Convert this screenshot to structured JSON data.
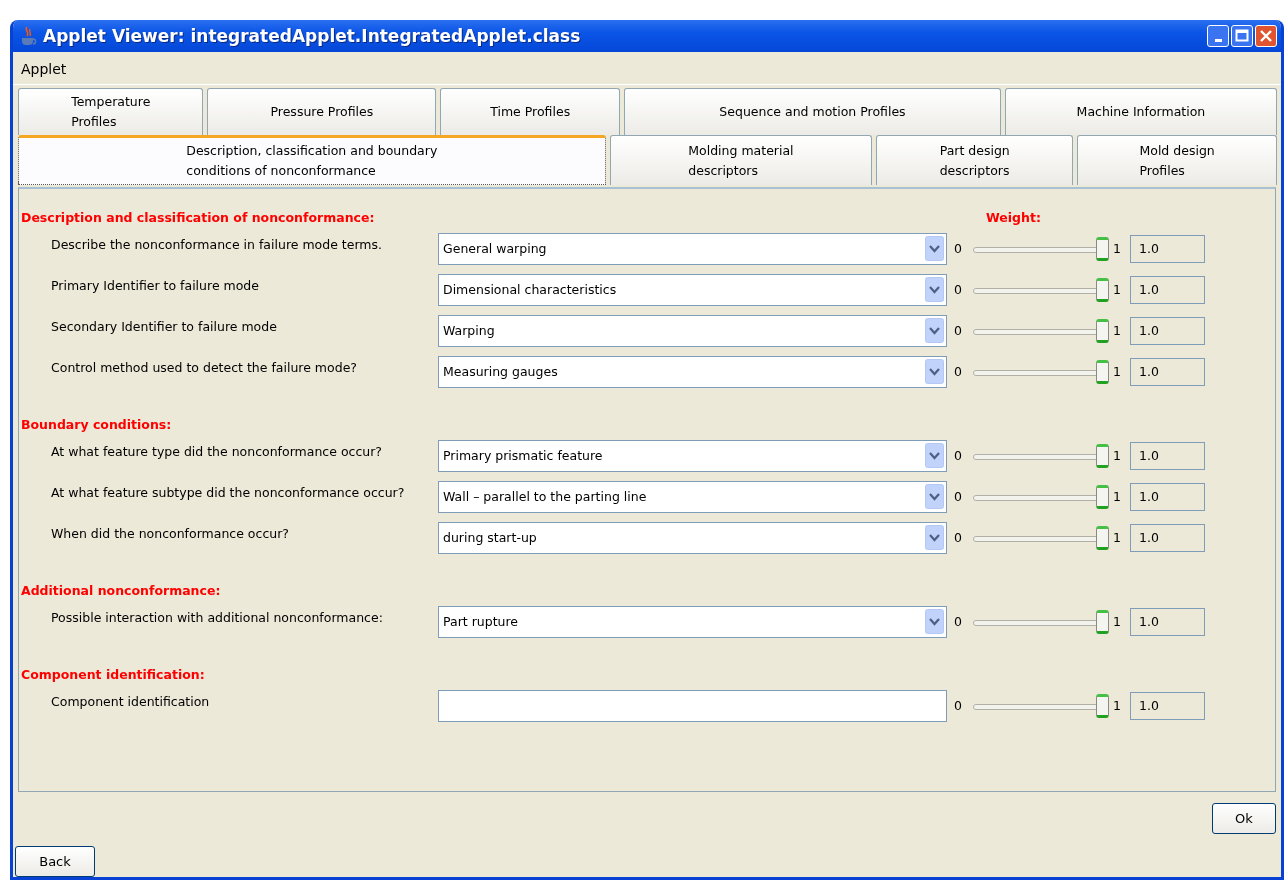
{
  "window": {
    "title": "Applet Viewer: integratedApplet.IntegratedApplet.class"
  },
  "menu": [
    "Applet"
  ],
  "tab_rows": [
    [
      {
        "label": "Temperature\nProfiles",
        "selected": false
      },
      {
        "label": "Pressure Profiles",
        "selected": false
      },
      {
        "label": "Time Profiles",
        "selected": false
      },
      {
        "label": "Sequence and motion Profiles",
        "selected": false
      },
      {
        "label": "Machine Information",
        "selected": false
      }
    ],
    [
      {
        "label": "Description, classification and boundary\nconditions of nonconformance",
        "selected": true
      },
      {
        "label": "Molding material\ndescriptors",
        "selected": false
      },
      {
        "label": "Part design\ndescriptors",
        "selected": false
      },
      {
        "label": "Mold design\nProfiles",
        "selected": false
      }
    ]
  ],
  "weight_heading": "Weight:",
  "sections": [
    {
      "heading": "Description and classification of nonconformance:",
      "rows": [
        {
          "label": "Describe the nonconformance in failure mode terms.",
          "kind": "dropdown",
          "value": "General warping",
          "min": "0",
          "max": "1",
          "level": 1,
          "reading": "1.0"
        },
        {
          "label": "Primary Identifier to failure mode",
          "kind": "dropdown",
          "value": "Dimensional characteristics",
          "min": "0",
          "max": "1",
          "level": 1,
          "reading": "1.0"
        },
        {
          "label": "Secondary Identifier to failure mode",
          "kind": "dropdown",
          "value": "Warping",
          "min": "0",
          "max": "1",
          "level": 1,
          "reading": "1.0"
        },
        {
          "label": "Control method used to detect the failure mode?",
          "kind": "dropdown",
          "value": "Measuring gauges",
          "min": "0",
          "max": "1",
          "level": 1,
          "reading": "1.0"
        }
      ]
    },
    {
      "heading": "Boundary conditions:",
      "rows": [
        {
          "label": "At what feature type did the nonconformance occur?",
          "kind": "dropdown",
          "value": "Primary prismatic feature",
          "min": "0",
          "max": "1",
          "level": 1,
          "reading": "1.0"
        },
        {
          "label": "At what feature subtype did the nonconformance occur?",
          "kind": "dropdown",
          "value": "Wall – parallel to the parting line",
          "min": "0",
          "max": "1",
          "level": 1,
          "reading": "1.0"
        },
        {
          "label": "When did the nonconformance occur?",
          "kind": "dropdown",
          "value": "during start-up",
          "min": "0",
          "max": "1",
          "level": 1,
          "reading": "1.0"
        }
      ]
    },
    {
      "heading": "Additional nonconformance:",
      "rows": [
        {
          "label": "Possible interaction with additional nonconformance:",
          "kind": "dropdown",
          "value": "Part rupture",
          "min": "0",
          "max": "1",
          "level": 1,
          "reading": "1.0"
        }
      ]
    },
    {
      "heading": "Component identification:",
      "rows": [
        {
          "label": "Component identification",
          "kind": "text",
          "min": "0",
          "max": "1",
          "level": 1,
          "reading": "1.0"
        }
      ]
    }
  ],
  "buttons": [
    "Ok",
    "Back"
  ]
}
